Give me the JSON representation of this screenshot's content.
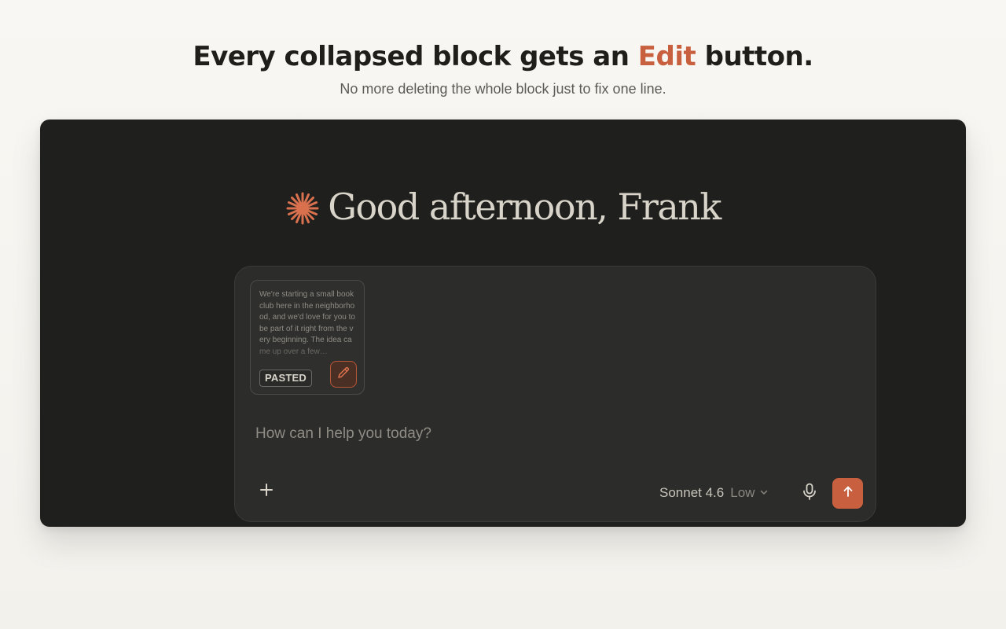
{
  "hero": {
    "title_before": "Every collapsed block gets an ",
    "title_accent": "Edit",
    "title_after": " button.",
    "subtitle": "No more deleting the whole block just to fix one line."
  },
  "app": {
    "greeting": "Good afternoon, Frank",
    "logo_icon": "sparkle-burst-icon",
    "composer": {
      "pasted_block": {
        "preview_text": "We're starting a small book club here in the neighborhood, and we'd love for you to be part of it right from the very beginning. The idea came up over a few…",
        "badge": "PASTED",
        "edit_icon": "pencil-icon"
      },
      "placeholder": "How can I help you today?",
      "add_icon": "plus-icon",
      "model": "Sonnet 4.6",
      "effort": "Low",
      "dropdown_icon": "chevron-down-icon",
      "mic_icon": "microphone-icon",
      "send_icon": "arrow-up-icon"
    }
  },
  "colors": {
    "accent": "#c8603f",
    "app_background": "#1f1f1d",
    "composer_background": "#2c2c2a",
    "page_background": "#f5f3ee"
  }
}
